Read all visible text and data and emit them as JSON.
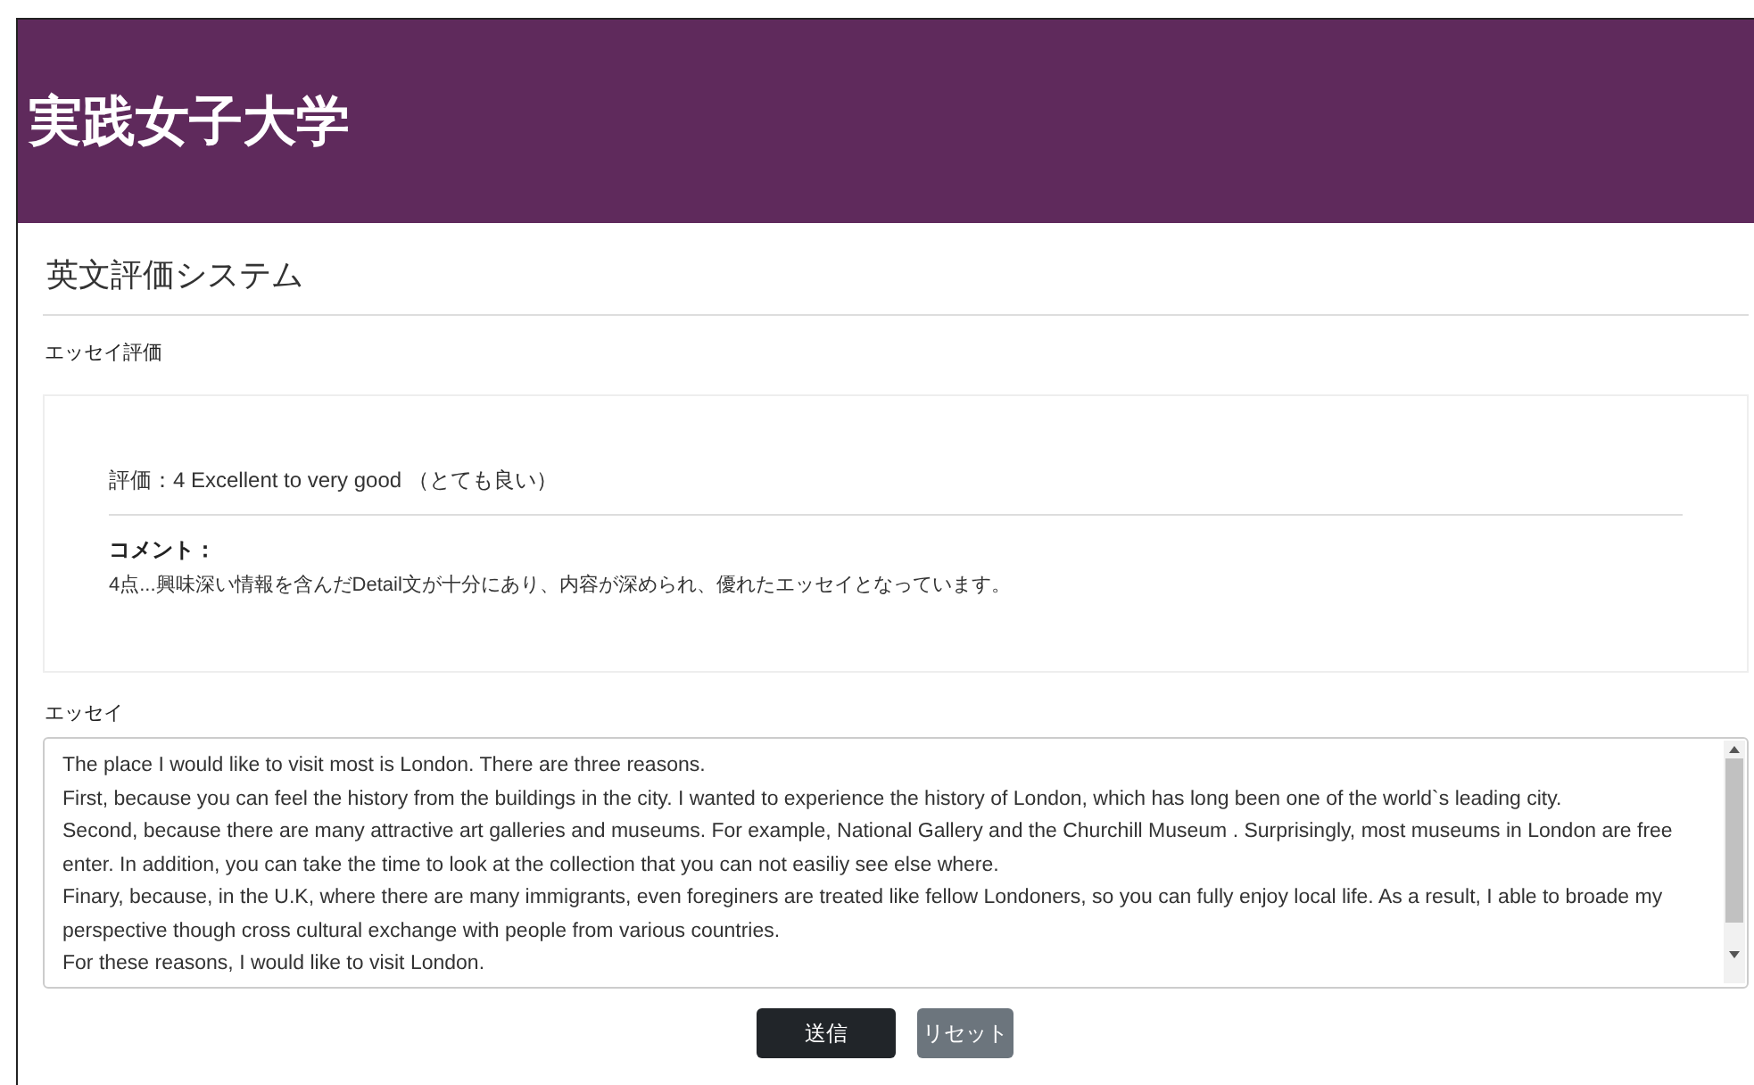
{
  "header": {
    "title": "実践女子大学"
  },
  "page": {
    "title": "英文評価システム"
  },
  "evaluation": {
    "label": "エッセイ評価",
    "rating": "評価：4 Excellent to very good （とても良い）",
    "comment_label": "コメント：",
    "comment": "4点...興味深い情報を含んだDetail文が十分にあり、内容が深められ、優れたエッセイとなっています。"
  },
  "essay": {
    "label": "エッセイ",
    "value": [
      "The place I would like to visit most is London. There are three reasons.",
      "First, because you can feel the history from the buildings in the city. I wanted to experience the history of London, which has long been one of the world`s leading city.",
      "Second, because there are many attractive art galleries and museums. For example, National Gallery and the Churchill Museum . Surprisingly, most museums in London are free enter. In addition, you can take the time to look at the collection that you can not easiliy see else where.",
      "Finary, because, in the U.K, where there are many immigrants, even foreginers are treated like fellow Londoners, so you can fully enjoy local life. As a result, I able to broade my perspective though cross cultural exchange with people from various countries.",
      "For these reasons, I would like to visit London."
    ]
  },
  "buttons": [
    {
      "label": "送信",
      "kind": "primary"
    },
    {
      "label": "リセット",
      "kind": "secondary"
    }
  ]
}
